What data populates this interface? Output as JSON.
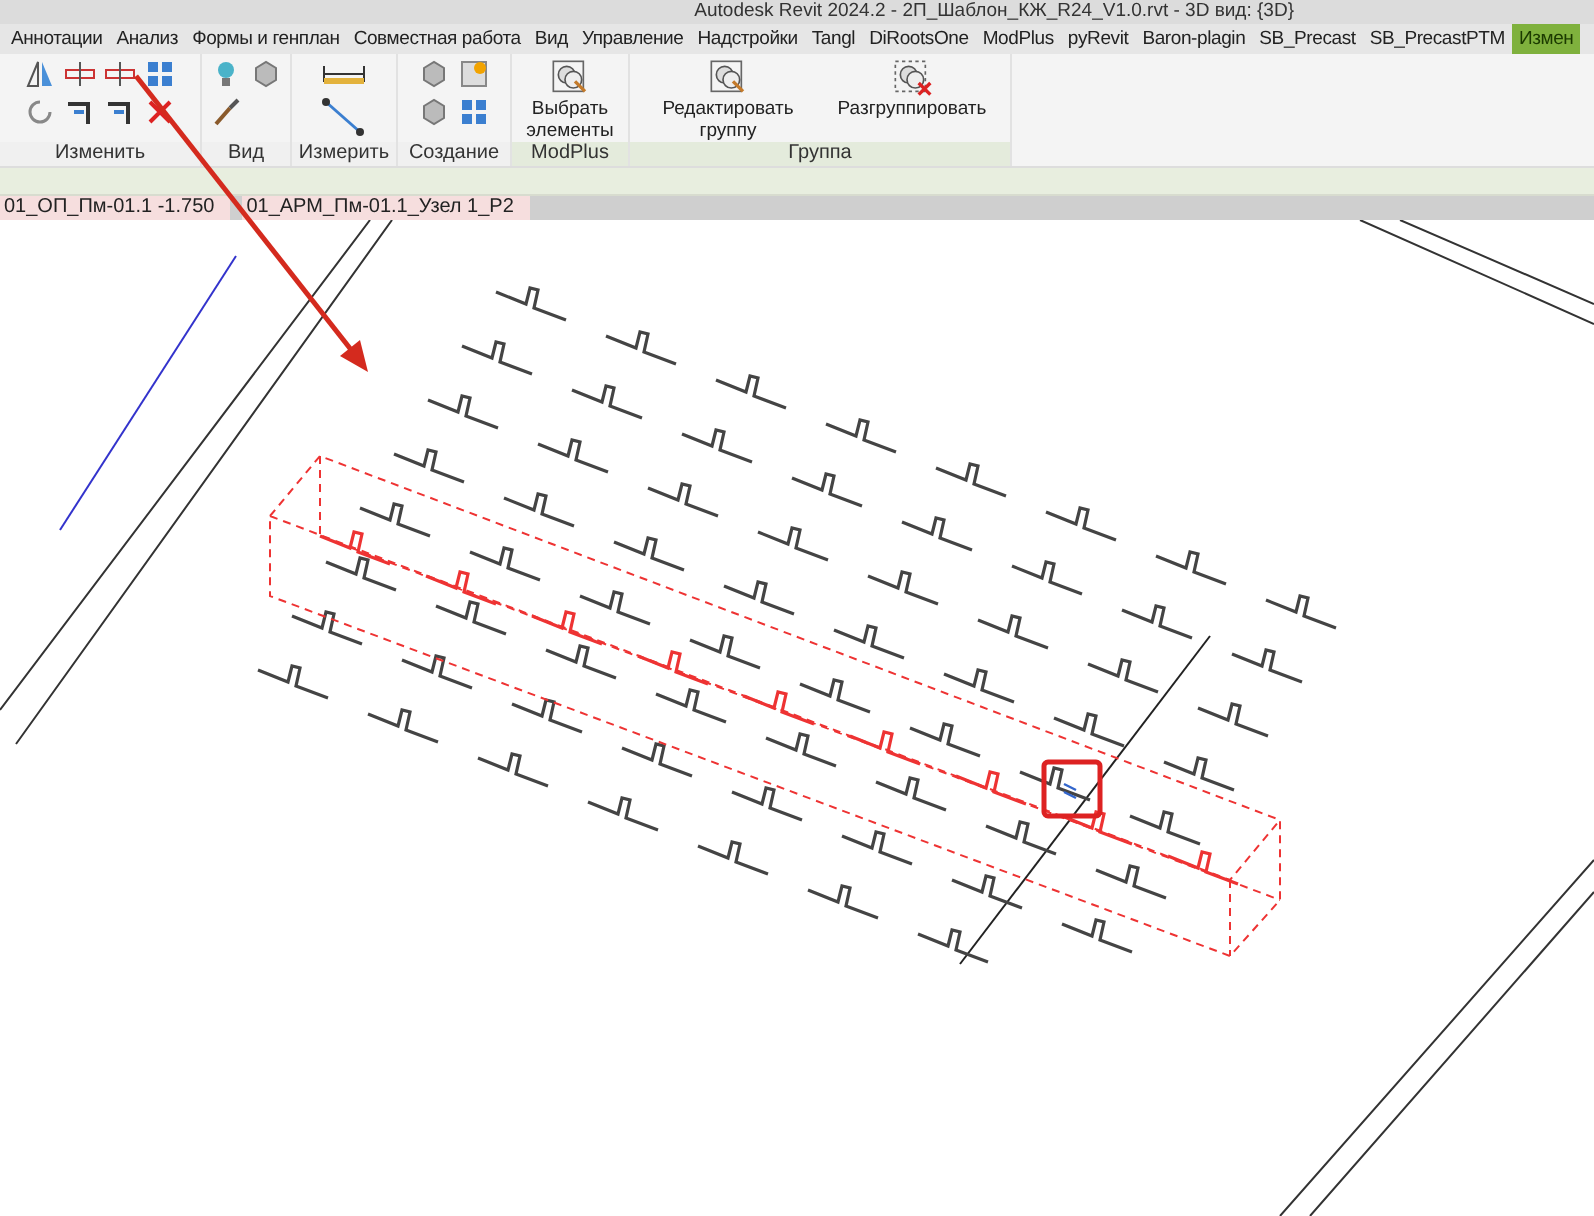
{
  "window": {
    "title": "Autodesk Revit 2024.2 - 2П_Шаблон_КЖ_R24_V1.0.rvt - 3D вид: {3D}"
  },
  "ribbon_tabs": [
    {
      "label": "Аннотации",
      "selected": false
    },
    {
      "label": "Анализ",
      "selected": false
    },
    {
      "label": "Формы и генплан",
      "selected": false
    },
    {
      "label": "Совместная работа",
      "selected": false
    },
    {
      "label": "Вид",
      "selected": false
    },
    {
      "label": "Управление",
      "selected": false
    },
    {
      "label": "Надстройки",
      "selected": false
    },
    {
      "label": "Tangl",
      "selected": false
    },
    {
      "label": "DiRootsOne",
      "selected": false
    },
    {
      "label": "ModPlus",
      "selected": false
    },
    {
      "label": "pyRevit",
      "selected": false
    },
    {
      "label": "Baron-plagin",
      "selected": false
    },
    {
      "label": "SB_Precast",
      "selected": false
    },
    {
      "label": "SB_PrecastPTM",
      "selected": false
    },
    {
      "label": "Измен",
      "selected": true
    }
  ],
  "panels": [
    {
      "kind": "icons",
      "label": "Изменить"
    },
    {
      "kind": "icons",
      "label": "Вид"
    },
    {
      "kind": "icons",
      "label": "Измерить"
    },
    {
      "kind": "icons",
      "label": "Создание"
    },
    {
      "kind": "buttons",
      "label": "ModPlus",
      "buttons": [
        {
          "label": "Выбрать элементы"
        }
      ]
    },
    {
      "kind": "buttons",
      "label": "Группа",
      "buttons": [
        {
          "label": "Редактировать группу"
        },
        {
          "label": "Разгруппировать"
        }
      ]
    }
  ],
  "view_tabs": [
    {
      "label": "01_ОП_Пм-01.1 -1.750"
    },
    {
      "label": "01_АРМ_Пм-01.1_Узел 1_Р2"
    }
  ]
}
